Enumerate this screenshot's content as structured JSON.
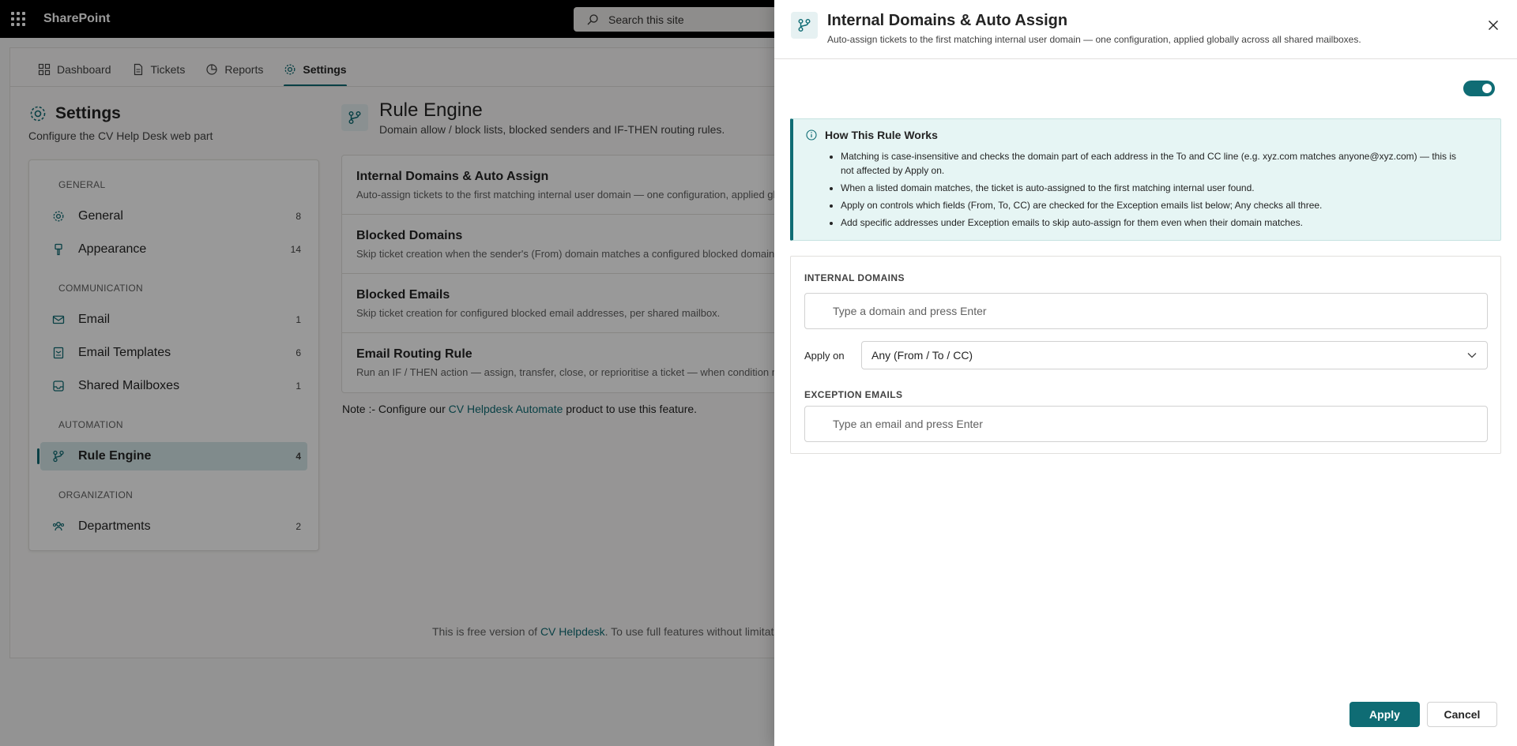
{
  "suite": {
    "brand": "SharePoint",
    "search_placeholder": "Search this site"
  },
  "topnav": {
    "tabs": [
      {
        "label": "Dashboard",
        "icon": "grid-icon"
      },
      {
        "label": "Tickets",
        "icon": "document-icon"
      },
      {
        "label": "Reports",
        "icon": "chart-icon"
      },
      {
        "label": "Settings",
        "icon": "gear-icon",
        "active": true
      }
    ]
  },
  "settings": {
    "title": "Settings",
    "subtitle": "Configure the CV Help Desk web part"
  },
  "sidebar": {
    "groups": {
      "general": "GENERAL",
      "communication": "COMMUNICATION",
      "automation": "AUTOMATION",
      "organization": "ORGANIZATION"
    },
    "items": [
      {
        "label": "General",
        "count": "8",
        "icon": "gear-icon"
      },
      {
        "label": "Appearance",
        "count": "14",
        "icon": "paint-brush-icon"
      },
      {
        "label": "Email",
        "count": "1",
        "icon": "mail-icon"
      },
      {
        "label": "Email Templates",
        "count": "6",
        "icon": "mail-template-icon"
      },
      {
        "label": "Shared Mailboxes",
        "count": "1",
        "icon": "inbox-icon"
      },
      {
        "label": "Rule Engine",
        "count": "4",
        "icon": "branch-icon",
        "active": true
      },
      {
        "label": "Departments",
        "count": "2",
        "icon": "people-team-icon"
      }
    ]
  },
  "rule_engine": {
    "title": "Rule Engine",
    "subtitle": "Domain allow / block lists, blocked senders and IF-THEN routing rules.",
    "rules": [
      {
        "name": "Internal Domains & Auto Assign",
        "desc": "Auto-assign tickets to the first matching internal user domain — one configuration, applied globally across all shared mailboxes."
      },
      {
        "name": "Blocked Domains",
        "desc": "Skip ticket creation when the sender's (From) domain matches a configured blocked domain."
      },
      {
        "name": "Blocked Emails",
        "desc": "Skip ticket creation for configured blocked email addresses, per shared mailbox."
      },
      {
        "name": "Email Routing Rule",
        "desc": "Run an IF / THEN action — assign, transfer, close, or reprioritise a ticket — when condition matches."
      }
    ],
    "note_prefix": "Note :- Configure our ",
    "note_link": "CV Helpdesk Automate",
    "note_suffix": " product to use this feature."
  },
  "footer": {
    "prefix": "This is free version of ",
    "link": "CV Helpdesk",
    "suffix": ". To use full features without limitations."
  },
  "panel": {
    "title": "Internal Domains & Auto Assign",
    "subtitle": "Auto-assign tickets to the first matching internal user domain — one configuration, applied globally across all shared mailboxes.",
    "enabled": true,
    "info": {
      "title": "How This Rule Works",
      "bullets": [
        "Matching is case-insensitive and checks the domain part of each address in the To and CC line (e.g. xyz.com matches anyone@xyz.com) — this is not affected by Apply on.",
        "When a listed domain matches, the ticket is auto-assigned to the first matching internal user found.",
        "Apply on controls which fields (From, To, CC) are checked for the Exception emails list below; Any checks all three.",
        "Add specific addresses under Exception emails to skip auto-assign for them even when their domain matches."
      ]
    },
    "internal_domains_label": "INTERNAL DOMAINS",
    "internal_domains_placeholder": "Type a domain and press Enter",
    "apply_on_label": "Apply on",
    "apply_on_value": "Any (From / To / CC)",
    "exception_label": "EXCEPTION EMAILS",
    "exception_placeholder": "Type an email and press Enter",
    "apply_button": "Apply",
    "cancel_button": "Cancel"
  },
  "colors": {
    "accent": "#0f6c74",
    "info_bg": "#e6f5f4"
  }
}
